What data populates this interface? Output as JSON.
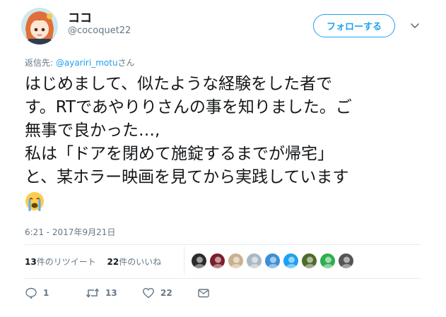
{
  "author": {
    "display_name": "ココ",
    "handle": "@cocoquet22"
  },
  "follow_button": {
    "label": "フォローする"
  },
  "reply_to": {
    "prefix": "返信先: ",
    "mention": "@ayariri_motu",
    "suffix": "さん"
  },
  "tweet": {
    "lines": [
      "はじめまして、似たような経験をした者で",
      "す。RTであやりりさんの事を知りました。ご",
      "無事で良かった…,",
      "私は「ドアを閉めて施錠するまでが帰宅」",
      "と、某ホラー映画を見てから実践しています"
    ],
    "emoji": "crying-face"
  },
  "timestamp": "6:21 - 2017年9月21日",
  "stats": {
    "retweets_count": "13",
    "retweets_label": "件のリツイート",
    "likes_count": "22",
    "likes_label": "件のいいね"
  },
  "likers": [
    {
      "name": "liker-1",
      "color": "#2b2b2b"
    },
    {
      "name": "liker-2",
      "color": "#7a1f2b"
    },
    {
      "name": "liker-3",
      "color": "#c9b28a"
    },
    {
      "name": "liker-4",
      "color": "#aab8c2"
    },
    {
      "name": "liker-5",
      "color": "#3b8fd6"
    },
    {
      "name": "liker-6",
      "color": "#1da1f2"
    },
    {
      "name": "liker-7",
      "color": "#4e6b2a"
    },
    {
      "name": "liker-8",
      "color": "#2fae4e"
    },
    {
      "name": "liker-9",
      "color": "#555555"
    }
  ],
  "actions": {
    "reply_count": "1",
    "retweet_count": "13",
    "like_count": "22"
  },
  "colors": {
    "accent": "#1da1f2",
    "secondary_text": "#657786",
    "primary_text": "#14171a",
    "divider": "#e6ecf0"
  }
}
